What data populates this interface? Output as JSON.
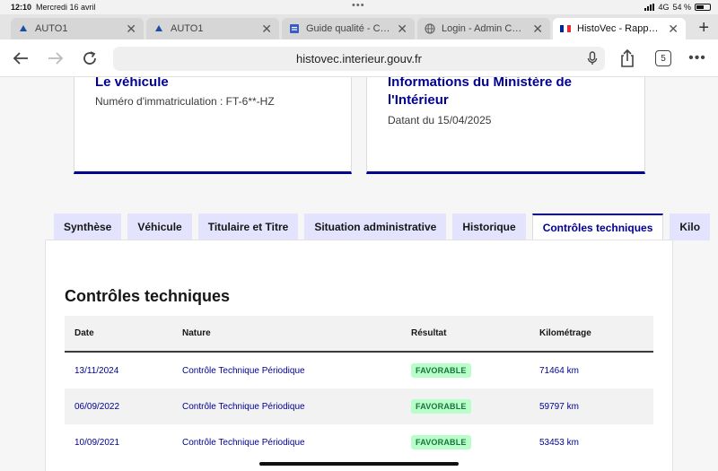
{
  "status": {
    "time": "12:10",
    "date": "Mercredi 16 avril",
    "network": "4G",
    "battery": "54 %"
  },
  "browser_tabs": [
    {
      "title": "AUTO1",
      "icon": "auto1-icon"
    },
    {
      "title": "AUTO1",
      "icon": "auto1-icon"
    },
    {
      "title": "Guide qualité - Comm",
      "icon": "doc-icon"
    },
    {
      "title": "Login - Admin Center",
      "icon": "globe-icon"
    },
    {
      "title": "HistoVec - Rapport ve",
      "icon": "flag-icon"
    }
  ],
  "toolbar": {
    "url": "histovec.interieur.gouv.fr",
    "tab_count": "5"
  },
  "cards": {
    "vehicle": {
      "title": "Le véhicule",
      "text": "Numéro d'immatriculation : FT-6**-HZ"
    },
    "ministry": {
      "title_line1": "Informations du Ministère de",
      "title_line2": "l'Intérieur",
      "text": "Datant du 15/04/2025"
    }
  },
  "page_tabs": [
    "Synthèse",
    "Véhicule",
    "Titulaire et Titre",
    "Situation administrative",
    "Historique",
    "Contrôles techniques",
    "Kilo"
  ],
  "section": {
    "title": "Contrôles techniques",
    "headers": [
      "Date",
      "Nature",
      "Résultat",
      "Kilométrage"
    ],
    "rows": [
      {
        "date": "13/11/2024",
        "nature": "Contrôle Technique Périodique",
        "result": "FAVORABLE",
        "km": "71464 km"
      },
      {
        "date": "06/09/2022",
        "nature": "Contrôle Technique Périodique",
        "result": "FAVORABLE",
        "km": "59797 km"
      },
      {
        "date": "10/09/2021",
        "nature": "Contrôle Technique Périodique",
        "result": "FAVORABLE",
        "km": "53453 km"
      }
    ]
  },
  "colors": {
    "primary": "#000091",
    "tab_bg": "#e3e3fd",
    "success_bg": "#b8fec9",
    "success_text": "#18753c"
  }
}
